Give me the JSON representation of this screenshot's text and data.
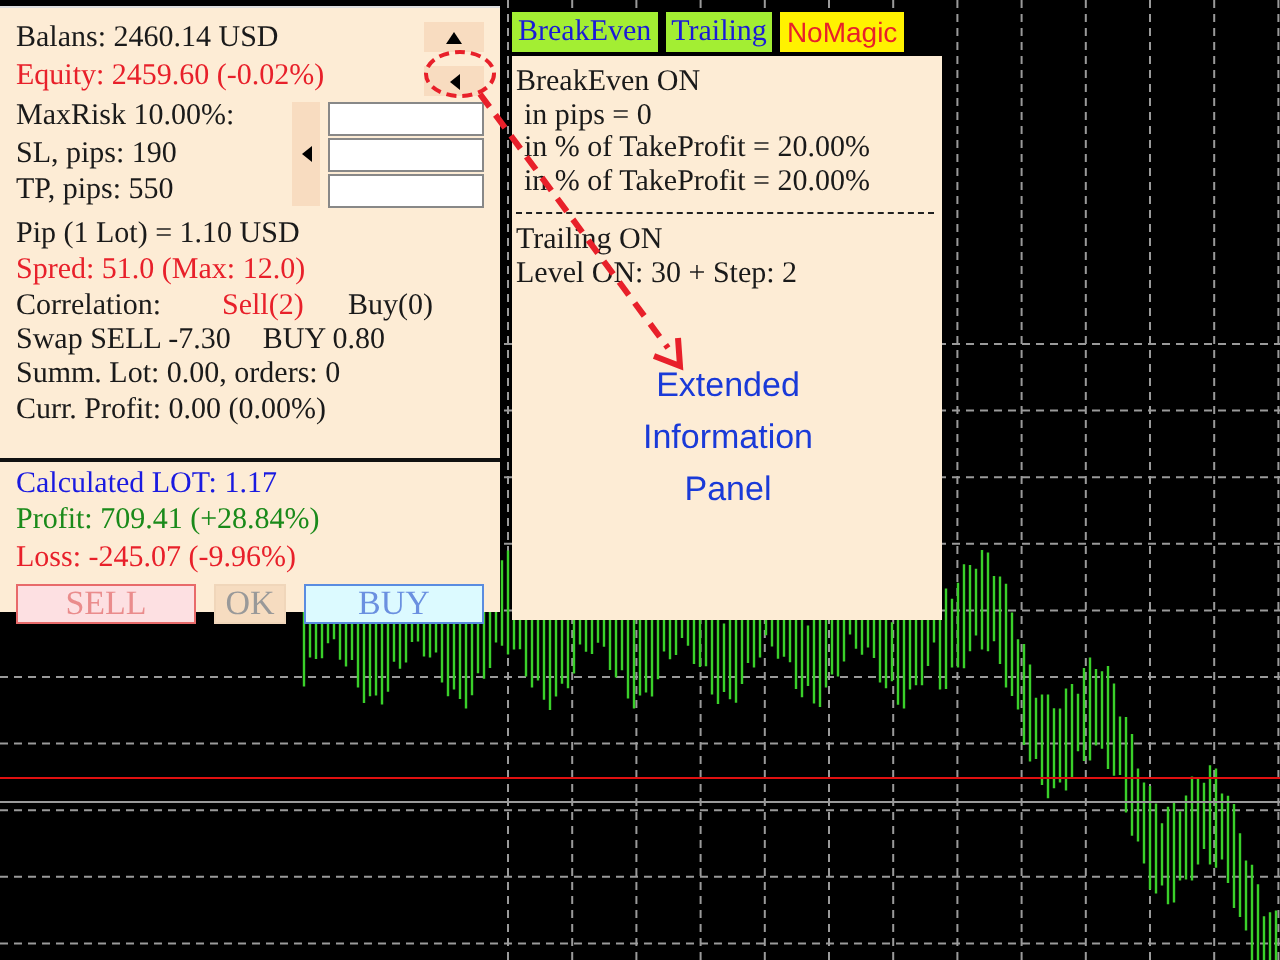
{
  "account": {
    "balance": "Balans: 2460.14 USD",
    "equity": "Equity: 2459.60 (-0.02%)"
  },
  "risk_fields": [
    {
      "label": "MaxRisk 10.00%:"
    },
    {
      "label": "SL, pips: 190"
    },
    {
      "label": "TP, pips: 550"
    }
  ],
  "info_lines": [
    {
      "text": "Pip (1 Lot) = 1.10 USD",
      "kind": "normal"
    },
    {
      "text": "Spred: 51.0 (Max: 12.0)",
      "kind": "warning"
    }
  ],
  "correlation": {
    "label": "Correlation:",
    "sell": "Sell(2)",
    "buy": "Buy(0)"
  },
  "swap": {
    "sell": "Swap SELL -7.30",
    "buy": "BUY 0.80"
  },
  "summary_lines": [
    {
      "text": "Summ. Lot: 0.00, orders: 0"
    },
    {
      "text": "Curr. Profit: 0.00 (0.00%)"
    }
  ],
  "results": [
    {
      "text": "Calculated LOT: 1.17",
      "kind": "lot"
    },
    {
      "text": "Profit: 709.41 (+28.84%)",
      "kind": "profit"
    },
    {
      "text": "Loss: -245.07 (-9.96%)",
      "kind": "loss"
    }
  ],
  "buttons": [
    {
      "label": "SELL",
      "kind": "sell"
    },
    {
      "label": "OK",
      "kind": "ok"
    },
    {
      "label": "BUY",
      "kind": "buy"
    }
  ],
  "tabs": [
    {
      "label": "BreakEven",
      "kind": "module"
    },
    {
      "label": "Trailing",
      "kind": "module"
    },
    {
      "label": "NoMagic",
      "kind": "warning"
    }
  ],
  "extended_panel": {
    "sections": [
      {
        "lines": [
          {
            "text": "BreakEven ON",
            "kind": "heading"
          },
          {
            "text": "in pips = 0",
            "kind": "sub"
          },
          {
            "text": "in % of TakeProfit = 20.00%",
            "kind": "sub"
          },
          {
            "text": "in % of TakeProfit = 20.00%",
            "kind": "sub"
          }
        ]
      },
      {
        "lines": [
          {
            "text": "Trailing ON",
            "kind": "heading"
          },
          {
            "text": "Level ON: 30 + Step: 2",
            "kind": "heading"
          }
        ]
      }
    ]
  },
  "annotation": {
    "text": "Extended Information Panel"
  }
}
